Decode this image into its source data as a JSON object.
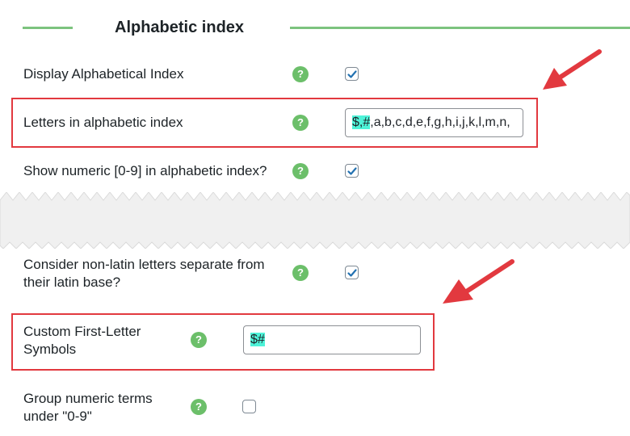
{
  "section": {
    "title": "Alphabetic index"
  },
  "help_glyph": "?",
  "rows": {
    "display_index": {
      "label": "Display Alphabetical Index",
      "checked": true
    },
    "letters": {
      "label": "Letters in alphabetic index",
      "value_highlight": "$,#",
      "value_rest": ",a,b,c,d,e,f,g,h,i,j,k,l,m,n,"
    },
    "numeric": {
      "label": "Show numeric [0-9] in alphabetic index?",
      "checked": true
    },
    "non_latin": {
      "label_line1": "Consider non-latin letters separate from",
      "label_line2": "their latin base?",
      "checked": true
    },
    "custom_symbols": {
      "label_line1": "Custom First-Letter",
      "label_line2": "Symbols",
      "value_highlight": "$#"
    },
    "group_numeric": {
      "label_line1": "Group numeric terms",
      "label_line2": "under \"0-9\"",
      "checked": false
    }
  },
  "colors": {
    "accent_green": "#7cc37e",
    "help_green": "#6cbf6a",
    "highlight_red": "#e2393f",
    "text_highlight": "#4ef3d8",
    "check_blue": "#2271b1"
  },
  "icons": [
    "help-icon",
    "checkmark-icon",
    "arrow-icon"
  ]
}
